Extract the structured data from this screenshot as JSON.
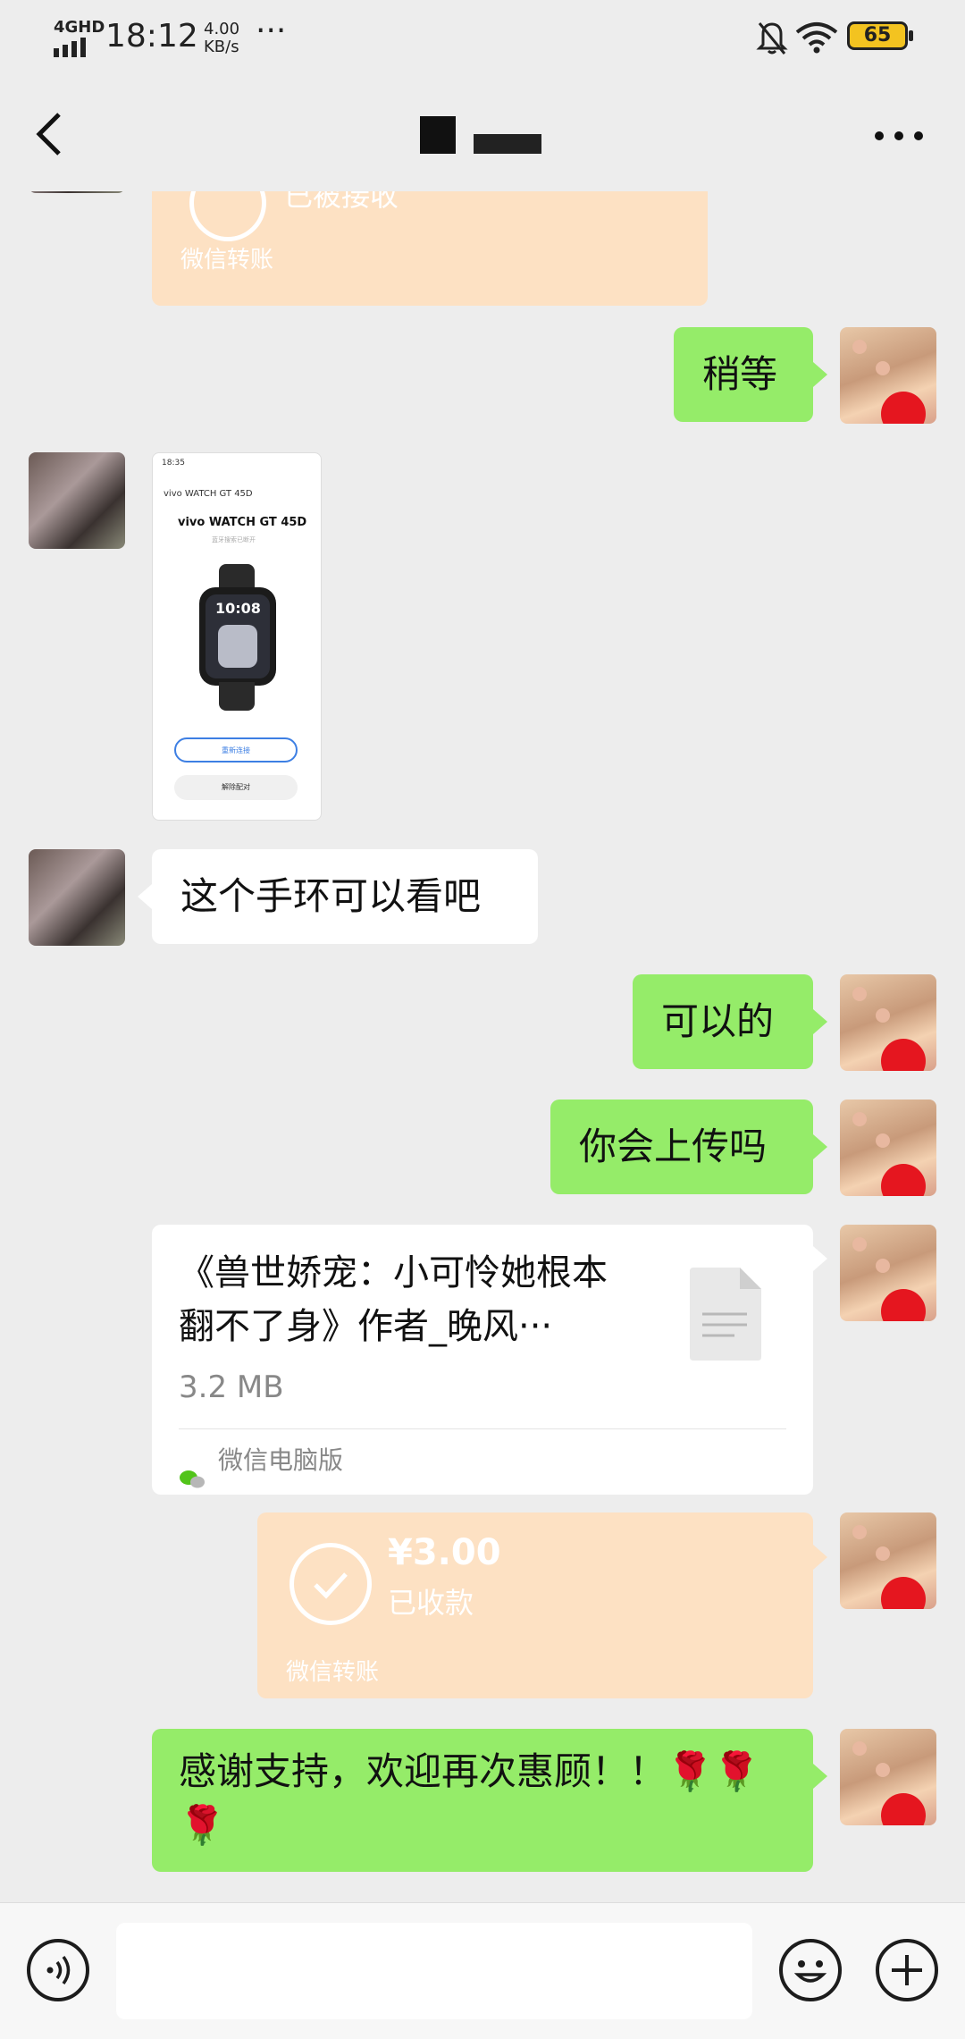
{
  "status_bar": {
    "network": "4GHD",
    "time": "18:12",
    "speed_value": "4.00",
    "speed_unit": "KB/s",
    "more": "···",
    "battery": "65"
  },
  "nav": {
    "title": "",
    "back_icon": "chevron-left-icon",
    "more_icon": "more-icon"
  },
  "messages": {
    "top_transfer": {
      "status": "已被接收",
      "footer": "微信转账"
    },
    "wait": "稍等",
    "screenshot": {
      "time": "18:35",
      "nav_label": "vivo WATCH GT 45D",
      "device_name": "vivo WATCH GT 45D",
      "subtitle": "蓝牙搜索已断开",
      "watch_time": "10:08",
      "reconnect": "重新连接",
      "unpair": "解除配对"
    },
    "can_view": "这个手环可以看吧",
    "yes": "可以的",
    "will_upload": "你会上传吗",
    "file": {
      "name": "《兽世娇宠：小可怜她根本翻不了身》作者_晚风···",
      "size": "3.2 MB",
      "source": "微信电脑版"
    },
    "payment": {
      "amount": "¥3.00",
      "status": "已收款",
      "footer": "微信转账"
    },
    "thanks": "感谢支持，欢迎再次惠顾！！🌹🌹🌹"
  },
  "input_bar": {
    "voice_icon": "voice-icon",
    "emoji_icon": "emoji-icon",
    "plus_icon": "plus-icon"
  },
  "colors": {
    "background": "#ededed",
    "bubble_green": "#95ec69",
    "bubble_white": "#ffffff",
    "transfer_orange": "#fde1c3"
  }
}
